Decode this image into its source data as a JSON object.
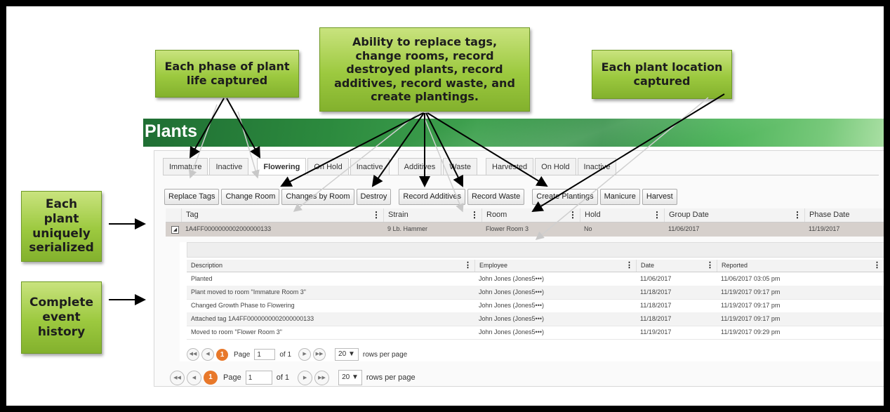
{
  "callouts": {
    "phase": "Each phase of plant life captured",
    "ability": "Ability to replace tags, change rooms, record destroyed plants, record additives, record waste, and create plantings.",
    "location": "Each plant location captured",
    "serialized": "Each plant uniquely serialized",
    "history": "Complete event history"
  },
  "app": {
    "title": "Plants",
    "tabs": [
      "Immature",
      "Inactive",
      "Flowering",
      "On Hold",
      "Inactive",
      "Additives",
      "Waste",
      "Harvested",
      "On Hold",
      "Inactive"
    ],
    "active_tab": "Flowering",
    "buttons": [
      "Replace Tags",
      "Change Room",
      "Changes by Room",
      "Destroy",
      "Record Additives",
      "Record Waste",
      "Create Plantings",
      "Manicure",
      "Harvest"
    ],
    "columns": [
      "Tag",
      "Strain",
      "Room",
      "Hold",
      "Group Date",
      "Phase Date"
    ],
    "row": {
      "tag": "1A4FF0000000002000000133",
      "strain": "9 Lb. Hammer",
      "room": "Flower Room 3",
      "hold": "No",
      "group_date": "11/06/2017",
      "phase_date": "11/19/2017"
    },
    "history": {
      "columns": [
        "Description",
        "Employee",
        "Date",
        "Reported"
      ],
      "rows": [
        {
          "description": "Planted",
          "employee": "John Jones (Jones5•••)",
          "date": "11/06/2017",
          "reported": "11/06/2017 03:05 pm"
        },
        {
          "description": "Plant moved to room \"Immature Room 3\"",
          "employee": "John Jones (Jones5•••)",
          "date": "11/18/2017",
          "reported": "11/19/2017 09:17 pm"
        },
        {
          "description": "Changed Growth Phase to Flowering",
          "employee": "John Jones (Jones5•••)",
          "date": "11/18/2017",
          "reported": "11/19/2017 09:17 pm"
        },
        {
          "description": "Attached tag 1A4FF0000000002000000133",
          "employee": "John Jones (Jones5•••)",
          "date": "11/18/2017",
          "reported": "11/19/2017 09:17 pm"
        },
        {
          "description": "Moved to room \"Flower Room 3\"",
          "employee": "John Jones (Jones5•••)",
          "date": "11/19/2017",
          "reported": "11/19/2017 09:29 pm"
        }
      ]
    },
    "pager": {
      "current": "1",
      "page_label": "Page",
      "page_value": "1",
      "of_label": "of 1",
      "rows_value": "20",
      "rows_label": "rows per page"
    }
  },
  "icons": {
    "first": "first-page-icon",
    "prev": "prev-page-icon",
    "next": "next-page-icon",
    "last": "last-page-icon",
    "kebab": "column-menu-icon",
    "expander": "expand-row-icon"
  },
  "colors": {
    "callout": "#9cc93f",
    "banner": "#2c8a3e",
    "pager_current": "#e8782a",
    "row_selected": "#d6d0cc"
  }
}
